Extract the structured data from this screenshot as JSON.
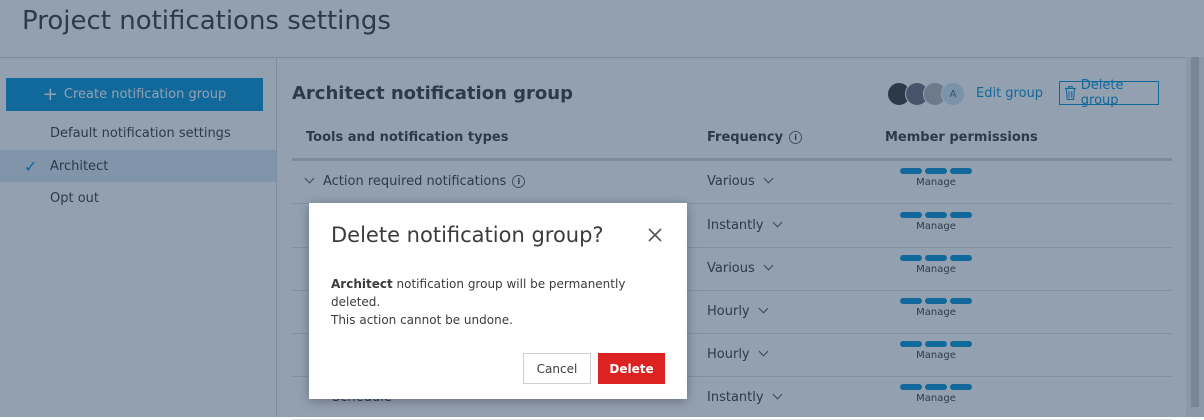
{
  "page": {
    "title": "Project notifications settings"
  },
  "sidebar": {
    "create_label": "Create notification group",
    "items": [
      {
        "label": "Default notification settings",
        "active": false
      },
      {
        "label": "Architect",
        "active": true
      },
      {
        "label": "Opt out",
        "active": false
      }
    ]
  },
  "group": {
    "title": "Architect notification group",
    "avatar_initial": "A",
    "edit_label": "Edit group",
    "delete_label": "Delete group"
  },
  "table": {
    "headers": {
      "tools": "Tools and notification types",
      "frequency": "Frequency",
      "permissions": "Member permissions"
    },
    "rows": [
      {
        "name": "Action required notifications",
        "frequency": "Various",
        "permission": "Manage"
      },
      {
        "name": "",
        "frequency": "Instantly",
        "permission": "Manage"
      },
      {
        "name": "",
        "frequency": "Various",
        "permission": "Manage"
      },
      {
        "name": "",
        "frequency": "Hourly",
        "permission": "Manage"
      },
      {
        "name": "",
        "frequency": "Hourly",
        "permission": "Manage"
      },
      {
        "name": "Schedule",
        "frequency": "Instantly",
        "permission": "Manage"
      }
    ]
  },
  "modal": {
    "title": "Delete notification group?",
    "group_name": "Architect",
    "message_rest": " notification group will be permanently deleted.",
    "message_line2": "This action cannot be undone.",
    "cancel_label": "Cancel",
    "delete_label": "Delete"
  },
  "colors": {
    "accent": "#0696d7",
    "danger": "#dd2222",
    "overlay": "#1e385a"
  }
}
